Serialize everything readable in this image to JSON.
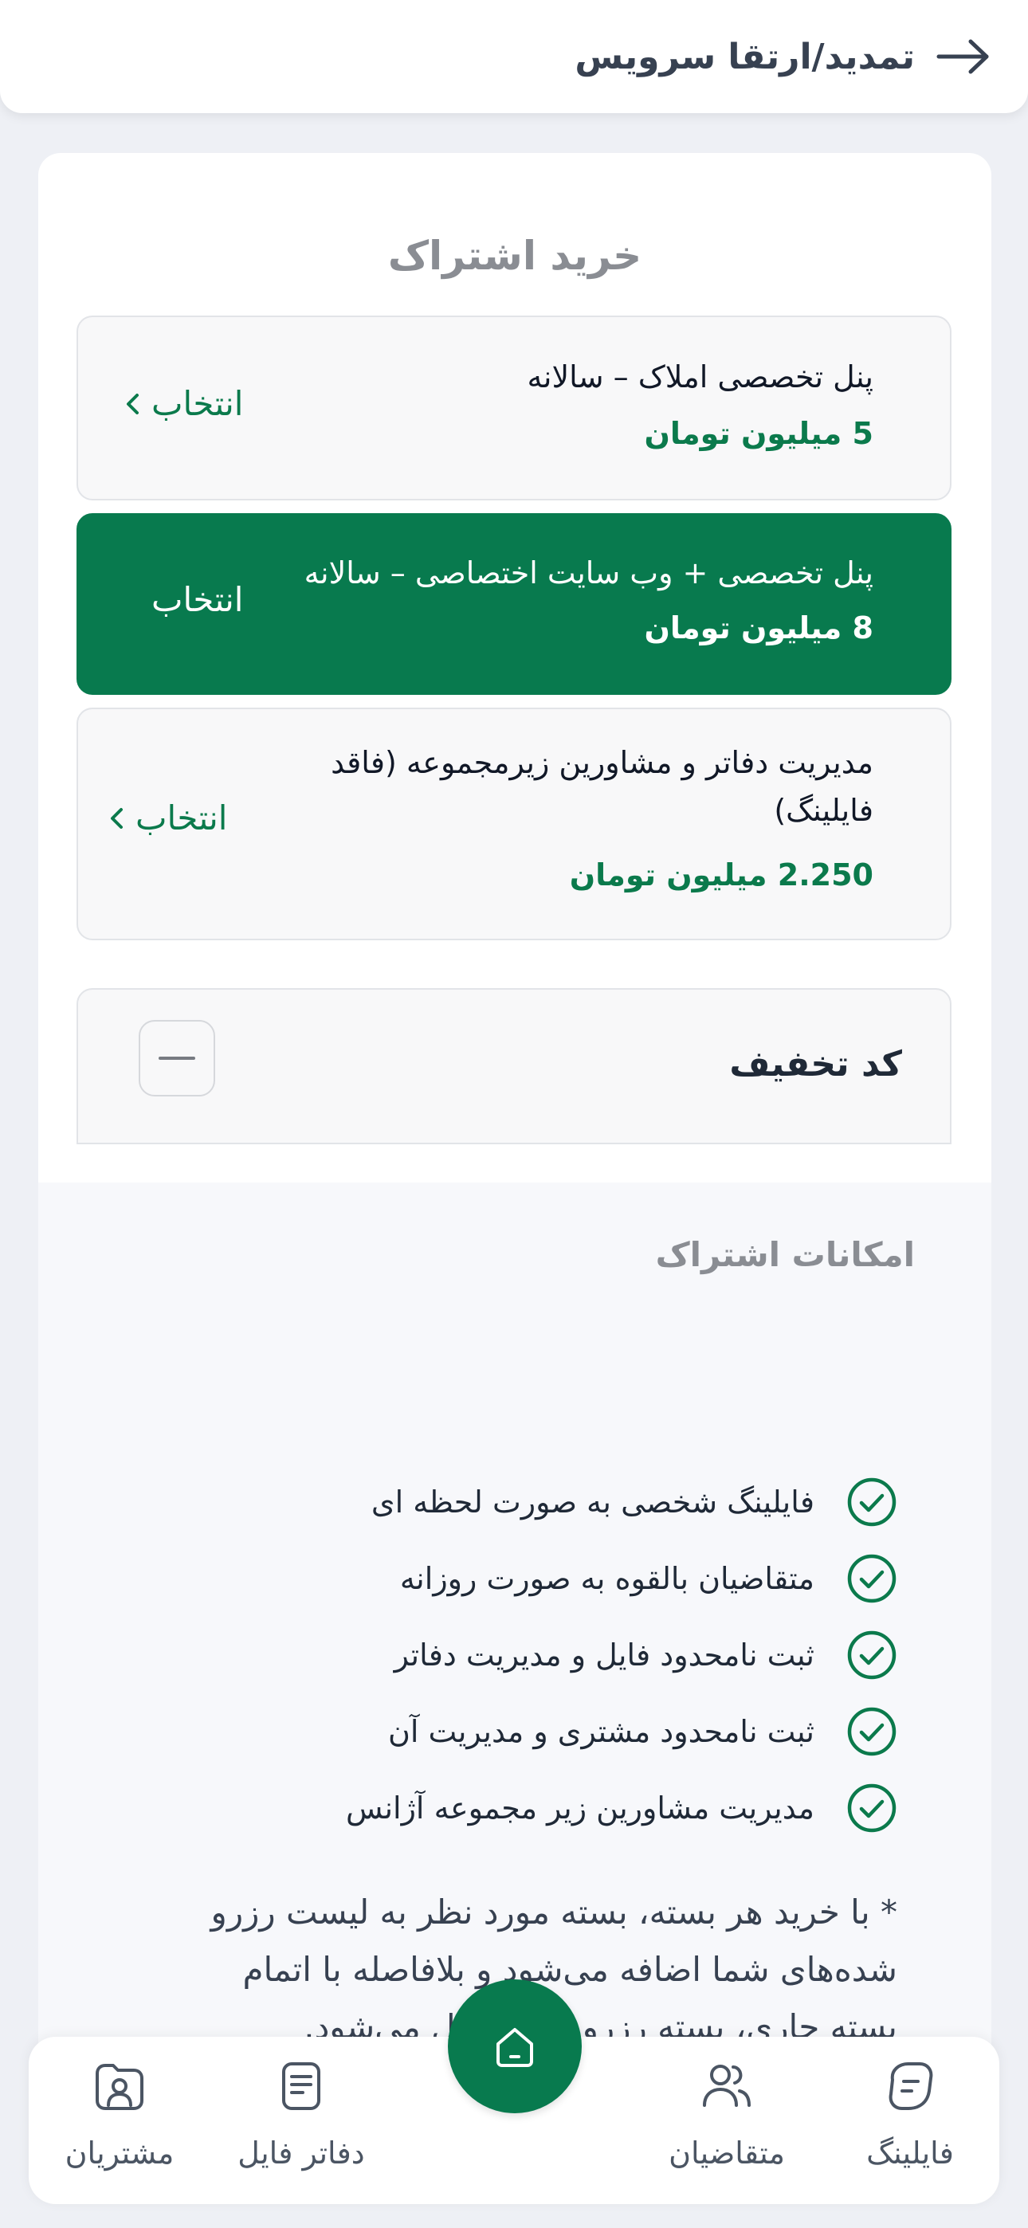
{
  "header": {
    "title": "تمدید/ارتقا سرویس"
  },
  "subscription": {
    "title": "خرید اشتراک",
    "plans": [
      {
        "name": "پنل تخصصی املاک – سالانه",
        "price": "5 میلیون تومان",
        "select_label": "انتخاب"
      },
      {
        "name": "پنل تخصصی + وب سایت اختصاصی – سالانه",
        "price": "8 میلیون تومان",
        "select_label": "انتخاب"
      },
      {
        "name_line1": "مدیریت دفاتر و مشاورین زیرمجموعه (فاقد",
        "name_line2": "فایلینگ)",
        "price": "2.250 میلیون تومان",
        "select_label": "انتخاب"
      }
    ]
  },
  "discount": {
    "label": "کد تخفیف"
  },
  "features": {
    "title": "امکانات اشتراک",
    "items": [
      "فایلینگ شخصی به صورت لحظه ای",
      "متقاضیان بالقوه به صورت روزانه",
      "ثبت نامحدود فایل و مدیریت دفاتر",
      "ثبت نامحدود مشتری و مدیریت آن",
      "مدیریت مشاورین زیر مجموعه آژانس"
    ],
    "note_line1": "* با خرید هر بسته، بسته مورد نظر به لیست رزرو",
    "note_line2": "شده‌های شما اضافه می‌شود و بلافاصله با اتمام",
    "note_line3": "بسته جاری، بسته رزرو شده فعال می‌شود."
  },
  "nav": {
    "filing": "فایلینگ",
    "applicants": "متقاضیان",
    "file_offices": "دفاتر فایل",
    "customers": "مشتریان"
  },
  "colors": {
    "primary": "#087a4e",
    "background": "#eef0f5"
  }
}
